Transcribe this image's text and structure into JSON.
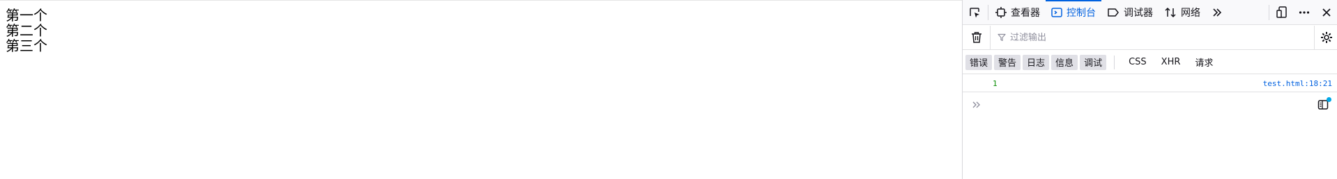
{
  "page": {
    "lines": [
      "第一个",
      "第二个",
      "第三个"
    ]
  },
  "devtools": {
    "tabs": [
      {
        "label": "查看器",
        "icon": "inspector-icon"
      },
      {
        "label": "控制台",
        "icon": "console-icon",
        "selected": true
      },
      {
        "label": "调试器",
        "icon": "debugger-icon"
      },
      {
        "label": "网络",
        "icon": "network-icon"
      }
    ],
    "filter": {
      "placeholder": "过滤输出"
    },
    "levels": [
      "错误",
      "警告",
      "日志",
      "信息",
      "调试"
    ],
    "types": [
      "CSS",
      "XHR",
      "请求"
    ],
    "messages": [
      {
        "value": "1",
        "location_file": "test.html",
        "location_line": ":18:21"
      }
    ],
    "colors": {
      "accent": "#0061e0",
      "number": "#058b00",
      "notify_dot": "#00a8e8"
    }
  }
}
